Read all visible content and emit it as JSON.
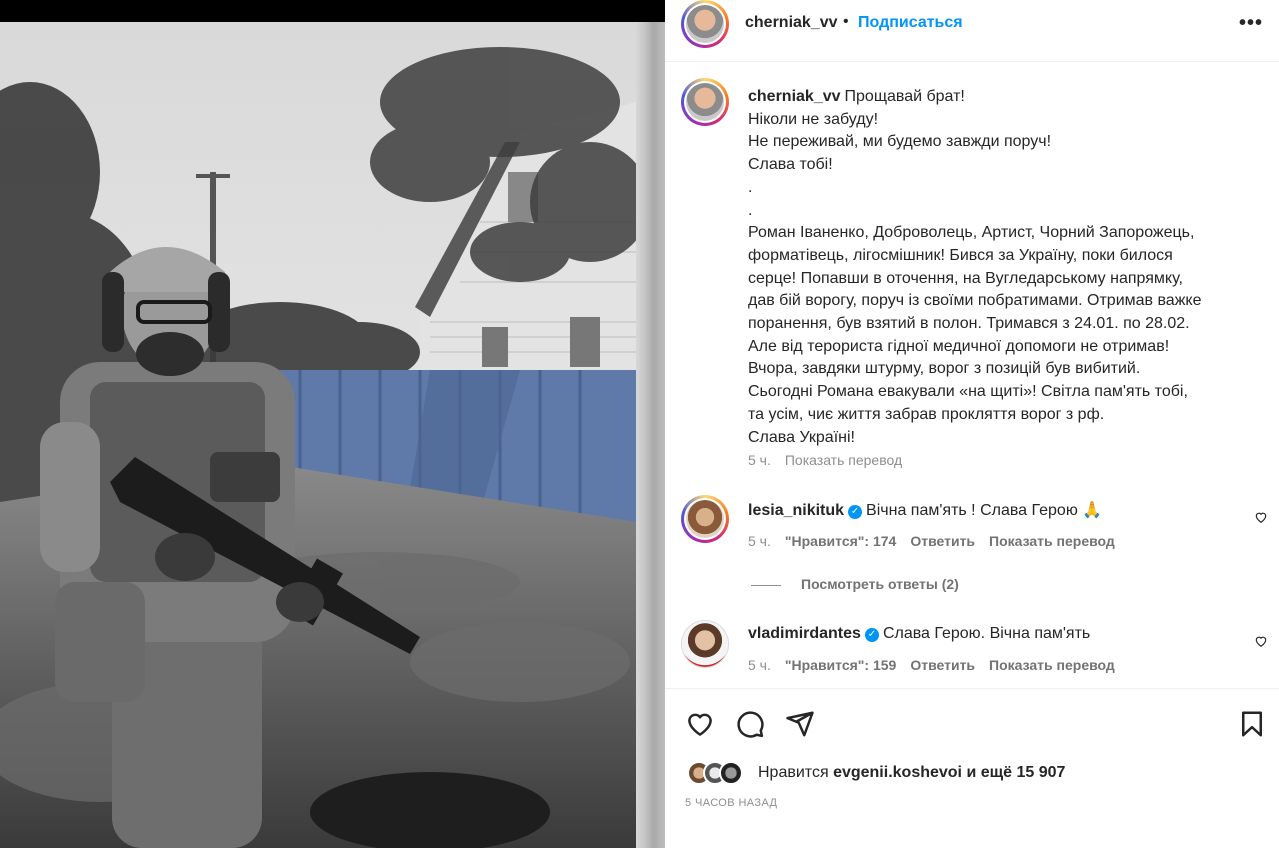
{
  "post": {
    "username": "cherniak_vv",
    "dot": "•",
    "follow_label": "Подписаться",
    "more_icon": "more-horizontal-icon",
    "more_glyph": "•••"
  },
  "caption": {
    "username": "cherniak_vv",
    "lines": [
      "Прощавай брат!",
      "Ніколи не забуду!",
      "Не переживай, ми будемо завжди поруч!",
      "Слава тобі!",
      ".",
      ".",
      "Роман Іваненко, Доброволець, Артист, Чорний Запорожець,",
      "форматівець, лігосмішник! Бився за Україну, поки билося",
      "серце! Попавши в оточення, на Вугледарському напрямку,",
      "дав бій ворогу, поруч із своїми побратимами. Отримав важке",
      "поранення, був взятий в полон. Тримався з 24.01. по 28.02.",
      "Але від терориста гідної медичної допомоги не отримав!",
      "Вчора, завдяки штурму, ворог з позицій був вибитий.",
      "Сьогодні Романа евакували «на щиті»! Світла пам'ять тобі,",
      "та усім, чиє життя забрав прокляття ворог з рф.",
      "Слава Україні!"
    ],
    "time": "5 ч.",
    "translate_label": "Показать перевод"
  },
  "comments": [
    {
      "username": "lesia_nikituk",
      "verified": true,
      "text": "Вічна пам'ять ! Слава Герою 🙏",
      "time": "5 ч.",
      "likes": "\"Нравится\": 174",
      "reply_label": "Ответить",
      "translate_label": "Показать перевод"
    },
    {
      "username": "vladimirdantes",
      "verified": true,
      "text": "Слава Герою. Вічна пам'ять",
      "time": "5 ч.",
      "likes": "\"Нравится\": 159",
      "reply_label": "Ответить",
      "translate_label": "Показать перевод"
    }
  ],
  "view_replies_label": "Посмотреть ответы (2)",
  "verified_glyph": "✓",
  "likes": {
    "prefix": "Нравится",
    "user": "evgenii.koshevoi",
    "suffix": "и ещё 15 907"
  },
  "time_ago": "5 ЧАСОВ НАЗАД",
  "icons": [
    "heart-icon",
    "comment-icon",
    "share-icon",
    "bookmark-icon"
  ],
  "colors": {
    "accent": "#0095f6",
    "text": "#262626",
    "secondary": "#8e8e8e",
    "fence": "#5f7aa8"
  }
}
